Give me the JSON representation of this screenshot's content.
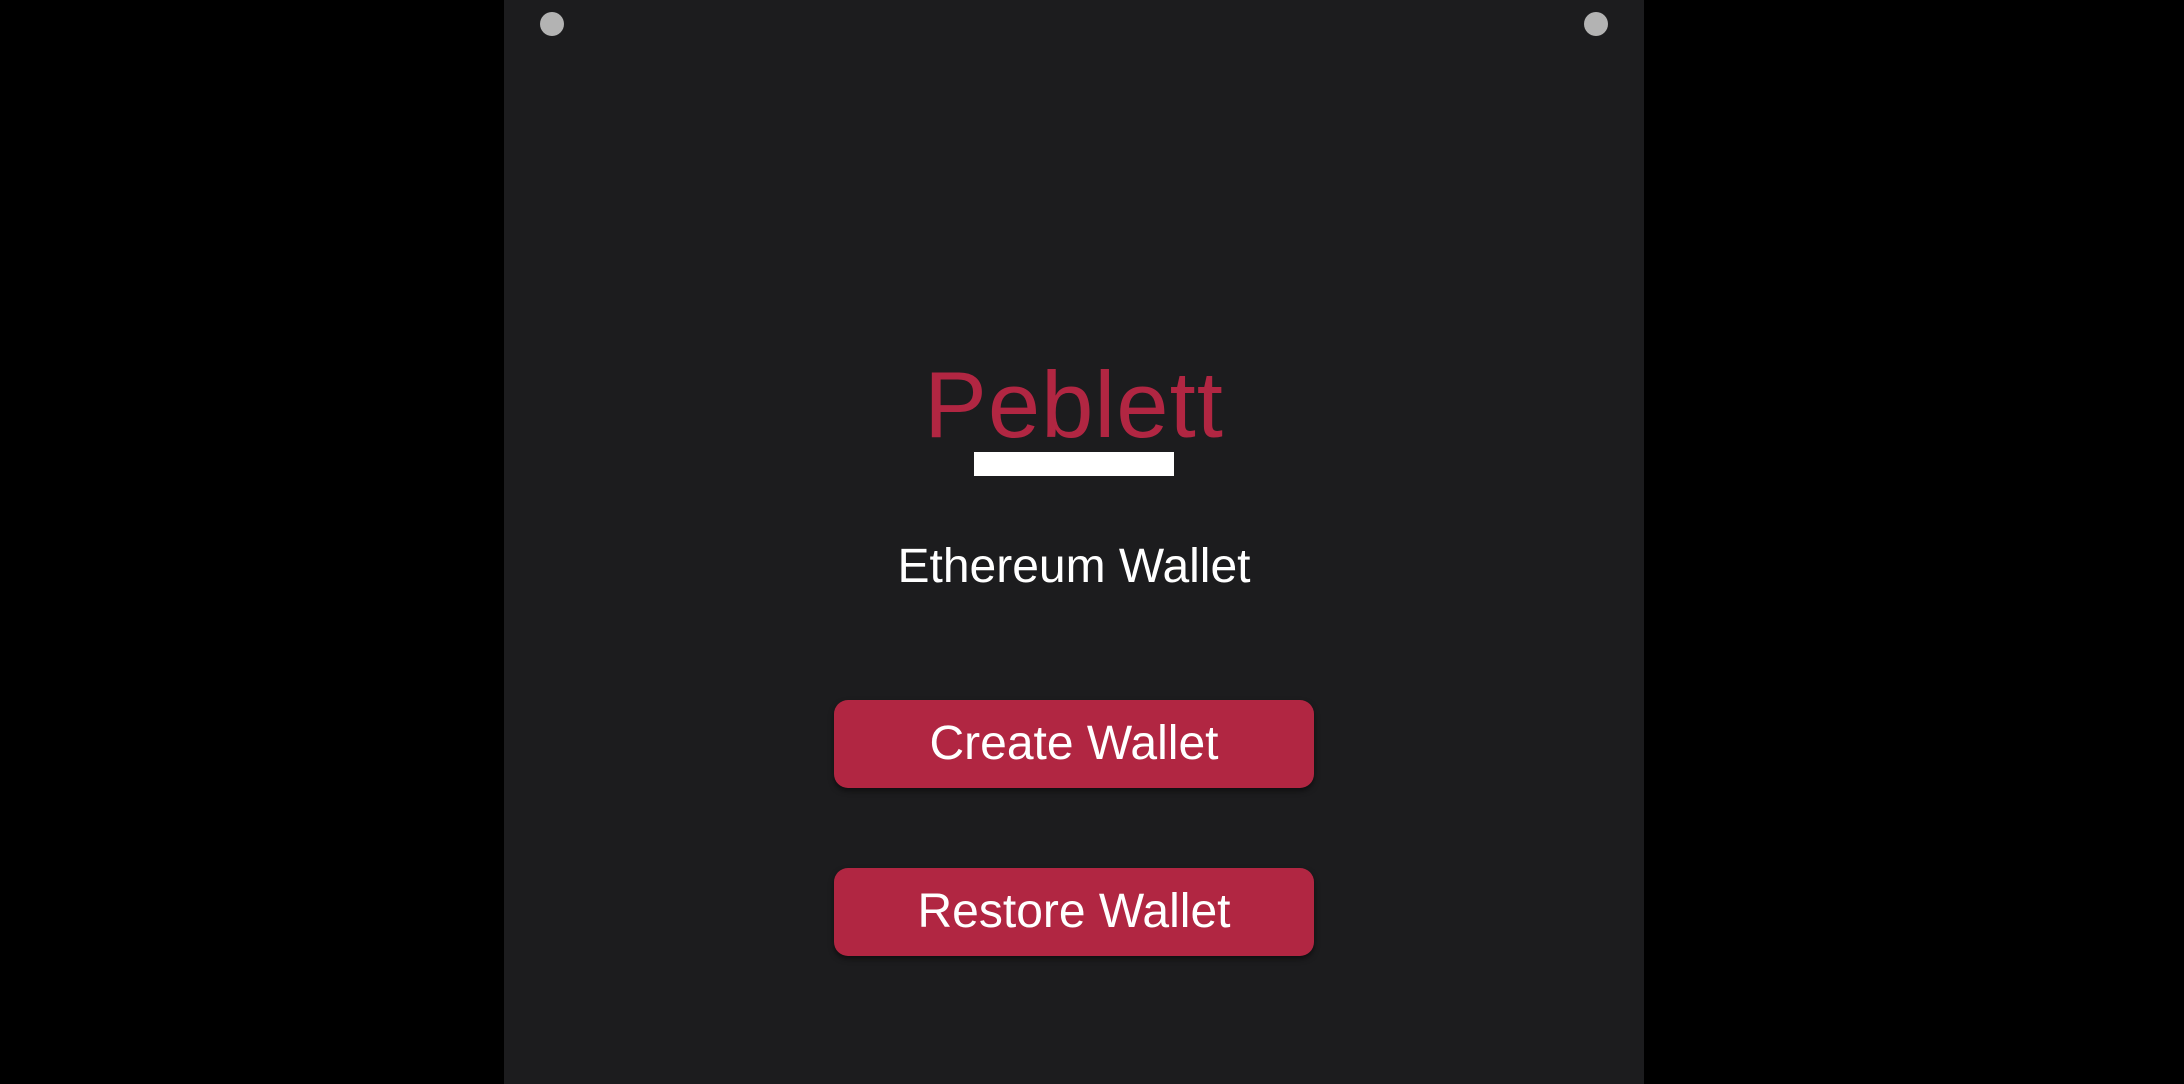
{
  "app": {
    "brand_name": "Peblett",
    "subtitle": "Ethereum Wallet"
  },
  "actions": {
    "create_label": "Create Wallet",
    "restore_label": "Restore Wallet"
  },
  "colors": {
    "accent": "#b12642",
    "background": "#1c1c1e",
    "outer_background": "#000000",
    "text": "#ffffff",
    "indicator_dot": "#b3b3b3"
  }
}
